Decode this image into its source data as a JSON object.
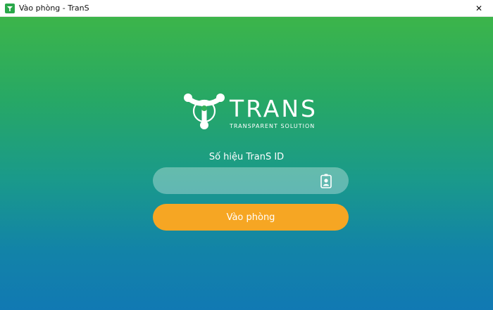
{
  "window": {
    "title": "Vào phòng - TranS",
    "close_glyph": "✕",
    "app_icon": "trans-logo-icon"
  },
  "logo": {
    "wordmark": "TRANS",
    "tagline": "TRANSPARENT SOLUTION"
  },
  "form": {
    "id_label": "Số hiệu TranS ID",
    "id_value": "",
    "id_placeholder": "",
    "id_icon": "id-badge-icon",
    "submit_label": "Vào phòng"
  },
  "colors": {
    "gradient_top": "#3cb54a",
    "gradient_bottom": "#1179b3",
    "button": "#f6a623"
  }
}
